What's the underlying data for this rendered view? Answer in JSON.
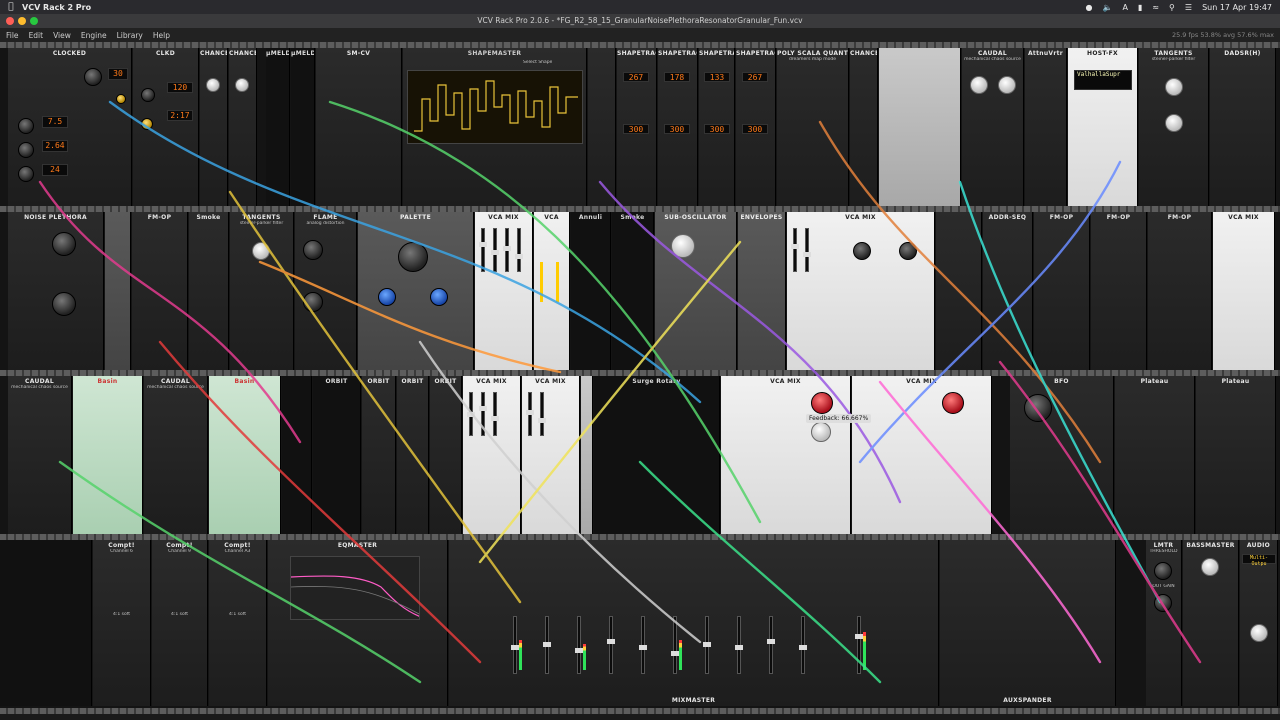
{
  "menubar": {
    "app_name": "VCV Rack 2 Pro",
    "datetime": "Sun 17 Apr  19:47"
  },
  "window": {
    "title": "VCV Rack Pro 2.0.6 - *FG_R2_58_15_GranularNoisePlethoraResonatorGranular_Fun.vcv"
  },
  "appmenu": {
    "items": [
      "File",
      "Edit",
      "View",
      "Engine",
      "Library",
      "Help"
    ],
    "performance": "25.9 fps  53.8% avg  57.6% max"
  },
  "tooltip": "Feedback: 66.667%",
  "rows": [
    {
      "modules": [
        {
          "title": "CLOCKED",
          "sub": "",
          "lcds": [
            "30",
            "7.5",
            "2.64",
            "24"
          ]
        },
        {
          "title": "CLKD",
          "sub": "",
          "lcds": [
            "120",
            "2:17"
          ]
        },
        {
          "title": "CHANCES",
          "sub": ""
        },
        {
          "title": "CHANCES",
          "sub": ""
        },
        {
          "title": "μMELD",
          "sub": ""
        },
        {
          "title": "μMELD",
          "sub": ""
        },
        {
          "title": "SM-CV",
          "sub": ""
        },
        {
          "title": "SHAPEMASTER",
          "sub": "Select Shape"
        },
        {
          "title": "SHAPETRACKER",
          "sub": "",
          "lcds": [
            "267",
            "300"
          ]
        },
        {
          "title": "SHAPETRACKER",
          "sub": "",
          "lcds": [
            "178",
            "300"
          ]
        },
        {
          "title": "SHAPETRACKER",
          "sub": "",
          "lcds": [
            "133",
            "300"
          ]
        },
        {
          "title": "SHAPETRACKER",
          "sub": "",
          "lcds": [
            "267",
            "300"
          ]
        },
        {
          "title": "POLY SCALA QUANTIZER",
          "sub": "dreamers map mode"
        },
        {
          "title": "CHANCES",
          "sub": ""
        },
        {
          "title": "CAUDAL",
          "sub": "mechanical chaos source"
        },
        {
          "title": "AttnuVrtr",
          "sub": ""
        },
        {
          "title": "HOST-FX",
          "sub": "ValhallaSupr"
        },
        {
          "title": "TANGENTS",
          "sub": "steiner-parker filter"
        },
        {
          "title": "DADSR(H)",
          "sub": ""
        }
      ]
    },
    {
      "modules": [
        {
          "title": "NOISE PLETHORA",
          "sub": ""
        },
        {
          "title": "FM-OP",
          "sub": ""
        },
        {
          "title": "Smoke",
          "sub": ""
        },
        {
          "title": "TANGENTS",
          "sub": "steiner-parker filter"
        },
        {
          "title": "FLAME",
          "sub": "analog distortion"
        },
        {
          "title": "PALETTE",
          "sub": ""
        },
        {
          "title": "VCA MIX",
          "sub": ""
        },
        {
          "title": "VCA",
          "sub": ""
        },
        {
          "title": "Annuli",
          "sub": ""
        },
        {
          "title": "Smoke",
          "sub": ""
        },
        {
          "title": "SUB-OSCILLATOR",
          "sub": ""
        },
        {
          "title": "ENVELOPES",
          "sub": ""
        },
        {
          "title": "VCA MIX",
          "sub": ""
        },
        {
          "title": "ADDR-SEQ",
          "sub": ""
        },
        {
          "title": "FM-OP",
          "sub": ""
        },
        {
          "title": "FM-OP",
          "sub": ""
        },
        {
          "title": "FM-OP",
          "sub": ""
        },
        {
          "title": "VCA MIX",
          "sub": ""
        }
      ]
    },
    {
      "modules": [
        {
          "title": "CAUDAL",
          "sub": "mechanical chaos source"
        },
        {
          "title": "Basin",
          "sub": ""
        },
        {
          "title": "CAUDAL",
          "sub": "mechanical chaos source"
        },
        {
          "title": "Basin",
          "sub": ""
        },
        {
          "title": "ORBIT",
          "sub": ""
        },
        {
          "title": "ORBIT",
          "sub": ""
        },
        {
          "title": "ORBIT",
          "sub": ""
        },
        {
          "title": "ORBIT",
          "sub": ""
        },
        {
          "title": "VCA MIX",
          "sub": ""
        },
        {
          "title": "VCA MIX",
          "sub": ""
        },
        {
          "title": "Surge Rotary",
          "sub": ""
        },
        {
          "title": "VCA MIX",
          "sub": ""
        },
        {
          "title": "VCA MIX",
          "sub": ""
        },
        {
          "title": "BFO",
          "sub": ""
        },
        {
          "title": "Plateau",
          "sub": ""
        },
        {
          "title": "Plateau",
          "sub": ""
        }
      ]
    },
    {
      "modules": [
        {
          "title": "Compt!",
          "sub": "Channel 6",
          "mode": "4:1 soft"
        },
        {
          "title": "Compt!",
          "sub": "Channel 9",
          "mode": "4:1 soft"
        },
        {
          "title": "Compt!",
          "sub": "Channel A3",
          "mode": "4:1 soft"
        },
        {
          "title": "EQMASTER",
          "sub": ""
        },
        {
          "title": "MIXMASTER",
          "sub": ""
        },
        {
          "title": "AUXSPANDER",
          "sub": ""
        },
        {
          "title": "LMTR",
          "sub": "THRESHOLD",
          "sub2": "OUT GAIN"
        },
        {
          "title": "BASSMASTER",
          "sub": ""
        },
        {
          "title": "AUDIO",
          "sub": "Multi-Outpu"
        }
      ]
    }
  ]
}
